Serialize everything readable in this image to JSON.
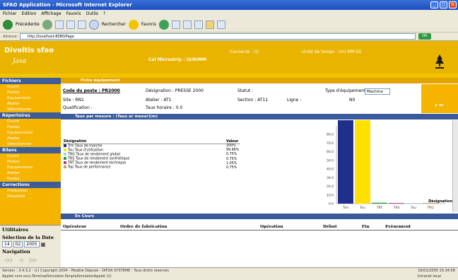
{
  "browser": {
    "title": "SFAO Application - Microsoft Internet Explorer",
    "menu": [
      "Fichier",
      "Edition",
      "Affichage",
      "Favoris",
      "Outils",
      "?"
    ],
    "toolbar": {
      "back": "Précédente",
      "search": "Rechercher",
      "favorites": "Favoris"
    },
    "address_label": "Adresse",
    "address": "http://localhost:8080/Page",
    "go": "OK"
  },
  "header": {
    "brand": "Divoltis sfao",
    "logo": "Java",
    "center": "Cal Microstrip : (à)KIMM",
    "mid": "Connecté : (|)",
    "right": "Unité de temps : (m) MM:SS"
  },
  "sidebar": {
    "sections": [
      {
        "title": "Fichiers",
        "items": [
          "Ouvrir",
          "Postes",
          "Equipement",
          "Atelier",
          "Sélectionner"
        ]
      },
      {
        "title": "Répertoires",
        "items": [
          "Ouvrir",
          "Postes",
          "Equipements",
          "Atelier",
          "Sélectionner"
        ]
      },
      {
        "title": "Bilans",
        "items": [
          "Ouvrir",
          "Postes",
          "Equipements",
          "Atelier",
          "Postes"
        ]
      },
      {
        "title": "Corrections",
        "items": [
          "Production",
          "Résultats"
        ]
      }
    ],
    "utilities_label": "Utilitaires",
    "date_label": "Sélection de la Date",
    "date_day": "14",
    "date_month": "02",
    "date_year": "2005",
    "nav_label": "Navigation",
    "nav_buttons": [
      "◁◁",
      "◁",
      "▷▷"
    ]
  },
  "detail": {
    "panel_title": "Fiche équipement",
    "code_label": "Code du poste : PR2000",
    "designation": "Désignation : PRESSE 2000",
    "statut": "Statut :",
    "type_label": "Type d'équipement",
    "type_value": "Machine",
    "site": "Site : RN1",
    "atelier": "Atelier : AT1",
    "section": "Section : AT11",
    "ligne": "Ligne :",
    "ligne_value": "N0",
    "qualification": "Qualification :",
    "taux": "Taux horaire : 0.0"
  },
  "table_panel": {
    "title": "Taux par mesure : (Taux ar mesur)(m)",
    "headers": [
      "Désignation",
      "Valeur"
    ],
    "rows": [
      {
        "label": "Trm Taux de marché",
        "value": "100%",
        "color": "#1e2f8c"
      },
      {
        "label": "Tou Taux d'utilisation",
        "value": "99.96%",
        "color": "#ffe000"
      },
      {
        "label": "TRG Taux de rendement global",
        "value": "0.75%",
        "color": "#9fd2f0"
      },
      {
        "label": "TRS Taux de rendement synthétique",
        "value": "0.75%",
        "color": "#2a9c3a"
      },
      {
        "label": "TRT Taux de rendement technique",
        "value": "1.05%",
        "color": "#b23a8c"
      },
      {
        "label": "Top Taux de performance",
        "value": "0.75%",
        "color": "#c8a06a"
      }
    ]
  },
  "chart_data": {
    "type": "bar",
    "categories": [
      "Trm",
      "Tou",
      "TRT",
      "TRS",
      "Tou",
      "TRG"
    ],
    "values": [
      100,
      99.96,
      1.05,
      0.75,
      0.75,
      0.75
    ],
    "colors": [
      "#1e2f8c",
      "#ffe000",
      "#2a9c3a",
      "#b23a8c",
      "#9fd2f0",
      "#c8a06a"
    ],
    "xlabel": "Désignation",
    "ylabel": "",
    "ylim": [
      0,
      90
    ],
    "yticks": [
      0,
      10,
      20,
      30,
      40,
      50,
      60,
      70,
      80
    ],
    "ytick_labels": [
      "0.0",
      "10.0",
      "20.0",
      "30.0",
      "40.0",
      "50.0",
      "60.0",
      "70.0",
      "80.0"
    ],
    "grid": false
  },
  "ops": {
    "title": "En Cours",
    "columns": [
      "Opérateur",
      "Ordre de fabrication",
      "Opération",
      "Début",
      "Fin",
      "Evènement"
    ]
  },
  "status": {
    "left": "Version : 3.4.3.2 - (c) Copyright 2004 - Modèle Déposé - DIFOA SYSTEME - Tous droits réservés",
    "right": "16/02/2005 15:34:58",
    "task_left": "Applet com.sscs.TerminalSimulator.SimpleSimulatorApplet (1)",
    "task_right": "Intranet local"
  }
}
